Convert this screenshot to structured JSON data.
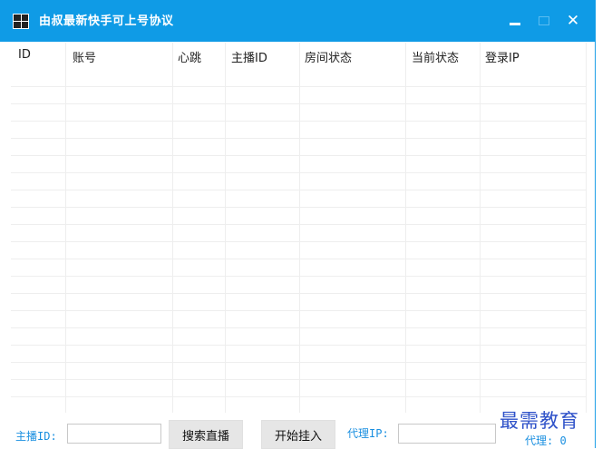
{
  "window": {
    "title": "由叔最新快手可上号协议"
  },
  "controls": {
    "minimize": "–",
    "maximize": "□",
    "close": "✕"
  },
  "table": {
    "columns": [
      "ID",
      "账号",
      "心跳",
      "主播ID",
      "房间状态",
      "当前状态",
      "登录IP"
    ],
    "rows": []
  },
  "bottom": {
    "anchor_label": "主播ID:",
    "anchor_value": "",
    "search_button": "搜索直播",
    "start_button": "开始挂入",
    "proxy_ip_label": "代理IP:",
    "proxy_ip_value": "",
    "proxy_count_label": "代理: 0"
  },
  "watermark": "最需教育",
  "colors": {
    "titlebar": "#0f9be6",
    "accent_text": "#1a8fe0",
    "watermark": "#2f52c9"
  }
}
